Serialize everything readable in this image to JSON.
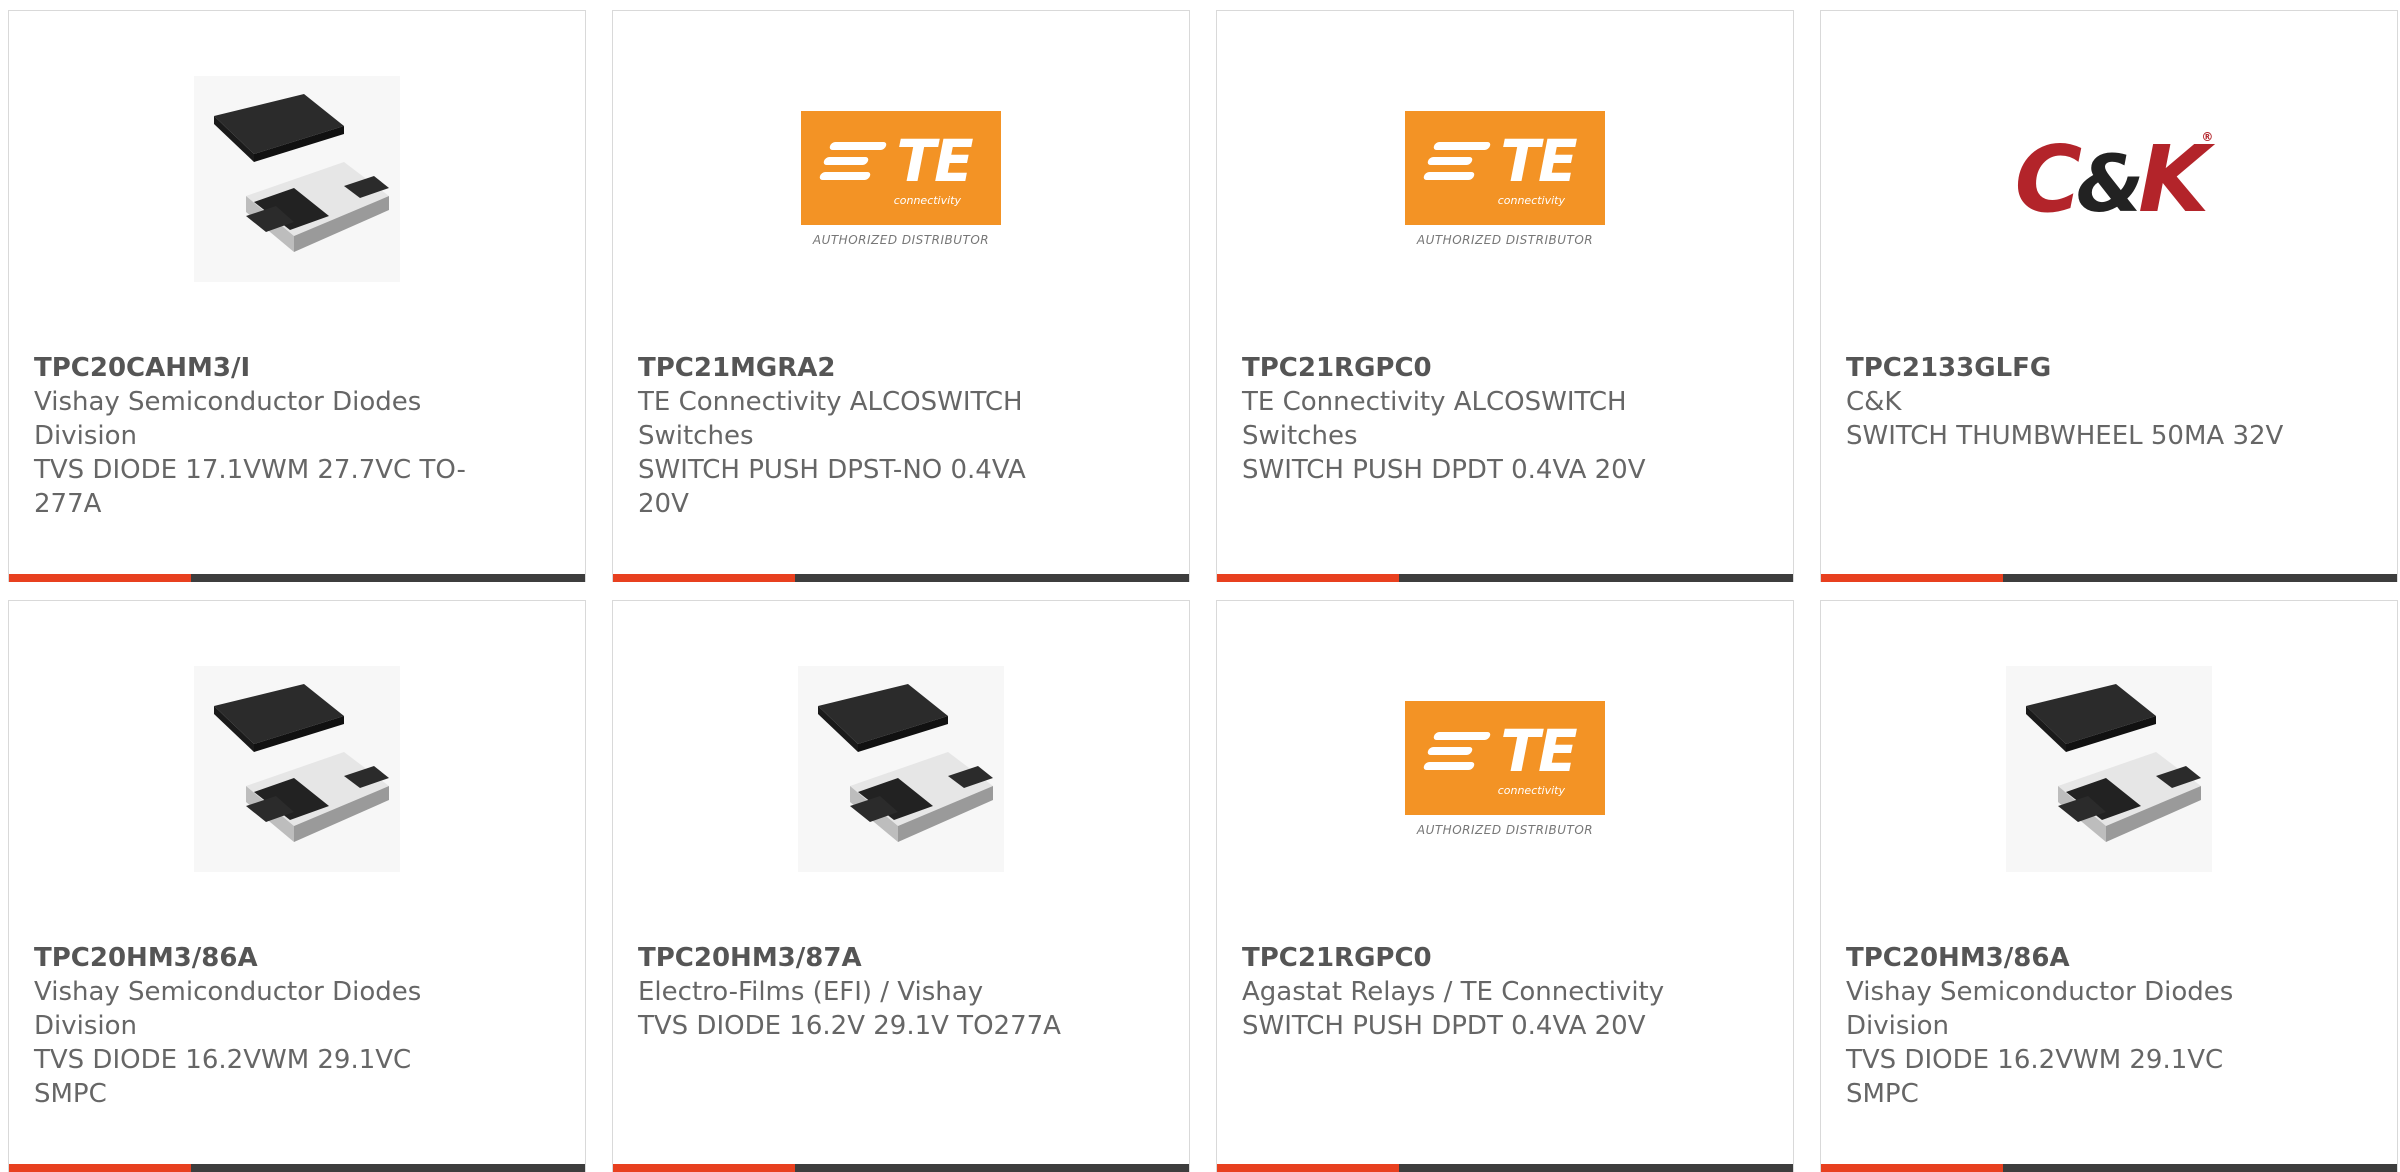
{
  "cards": [
    {
      "part_number": "TPC20CAHM3/I",
      "manufacturer": "Vishay Semiconductor Diodes Division",
      "description": "TVS DIODE 17.1VWM 27.7VC TO-277A",
      "image": "diode-package"
    },
    {
      "part_number": "TPC21MGRA2",
      "manufacturer": "TE Connectivity ALCOSWITCH Switches",
      "description": "SWITCH PUSH DPST-NO 0.4VA 20V",
      "image": "te-logo"
    },
    {
      "part_number": "TPC21RGPC0",
      "manufacturer": "TE Connectivity ALCOSWITCH Switches",
      "description": "SWITCH PUSH DPDT 0.4VA 20V",
      "image": "te-logo"
    },
    {
      "part_number": "TPC2133GLFG",
      "manufacturer": "C&K",
      "description": "SWITCH THUMBWHEEL 50MA 32V",
      "image": "ck-logo"
    },
    {
      "part_number": "TPC20HM3/86A",
      "manufacturer": "Vishay Semiconductor Diodes Division",
      "description": "TVS DIODE 16.2VWM 29.1VC SMPC",
      "image": "diode-package"
    },
    {
      "part_number": "TPC20HM3/87A",
      "manufacturer": "Electro-Films (EFI) / Vishay",
      "description": "TVS DIODE 16.2V 29.1V TO277A",
      "image": "diode-package"
    },
    {
      "part_number": "TPC21RGPC0",
      "manufacturer": "Agastat Relays / TE Connectivity",
      "description": "SWITCH PUSH DPDT 0.4VA 20V",
      "image": "te-logo"
    },
    {
      "part_number": "TPC20HM3/86A",
      "manufacturer": "Vishay Semiconductor Diodes Division",
      "description": "TVS DIODE 16.2VWM 29.1VC SMPC",
      "image": "diode-package"
    }
  ],
  "logos": {
    "te": {
      "letters": "TE",
      "sub": "connectivity",
      "authorized": "AUTHORIZED DISTRIBUTOR"
    },
    "ck": {
      "c": "C",
      "amp": "&",
      "k": "K",
      "tm": "®"
    }
  },
  "colors": {
    "accent": "#e8401f",
    "bar": "#3d3d3d",
    "te_orange": "#f39325",
    "ck_red": "#b3242a"
  }
}
